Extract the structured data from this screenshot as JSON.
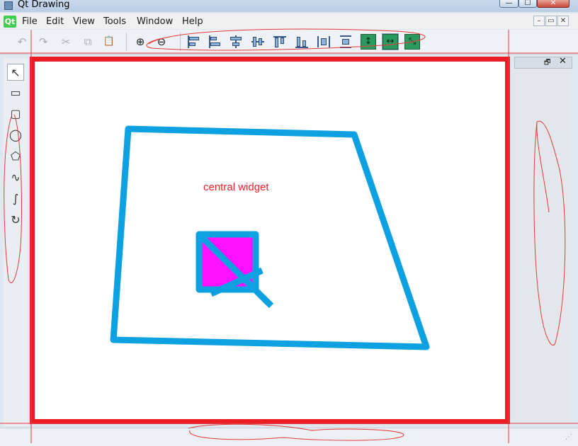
{
  "window": {
    "title": "Qt Drawing",
    "min_glyph": "—",
    "max_glyph": "☐",
    "close_glyph": "✕"
  },
  "menubar": {
    "logo": "Qt",
    "items": [
      "File",
      "Edit",
      "View",
      "Tools",
      "Window",
      "Help"
    ],
    "mdi": {
      "minimize": "–",
      "restore": "▭",
      "close": "✕"
    }
  },
  "toolbar": {
    "undo": "↶",
    "redo": "↷",
    "cut": "✂",
    "copy": "⧉",
    "paste": "📋",
    "zoom_in": "⊕",
    "zoom_out": "⊖",
    "same_width": "↔",
    "same_height": "↕",
    "same_size": "⤡"
  },
  "palette": {
    "pointer": "↖",
    "rect": "▭",
    "round_rect": "▢",
    "ellipse": "◯",
    "polygon": "⬠",
    "polyline": "∿",
    "bezier": "∫",
    "rotate": "↻"
  },
  "canvas": {
    "label": "central widget"
  },
  "dock": {
    "float": "🗗",
    "close": "✕"
  },
  "colors": {
    "accent_red": "#ec1c24",
    "shape_blue": "#0ea1e2",
    "fill_magenta": "#ff10ff"
  }
}
